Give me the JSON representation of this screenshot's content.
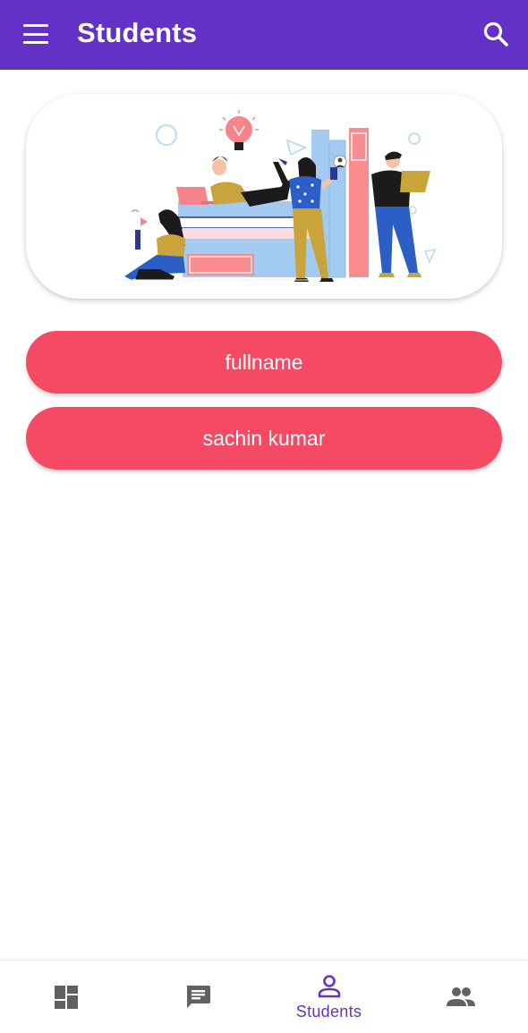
{
  "app_bar": {
    "title": "Students",
    "background": "#6331c5",
    "menu_icon": "menu-icon",
    "search_icon": "search-icon"
  },
  "hero": {
    "illustration": "students-studying-illustration"
  },
  "student_fields": [
    {
      "value": "fullname"
    },
    {
      "value": "sachin kumar"
    }
  ],
  "pill_color": "#f54a63",
  "bottom_nav": {
    "items": [
      {
        "icon": "dashboard-icon",
        "label": "",
        "active": false
      },
      {
        "icon": "chat-icon",
        "label": "",
        "active": false
      },
      {
        "icon": "person-icon",
        "label": "Students",
        "active": true
      },
      {
        "icon": "group-icon",
        "label": "",
        "active": false
      }
    ],
    "active_color": "#6331c5",
    "inactive_color": "#616161"
  }
}
